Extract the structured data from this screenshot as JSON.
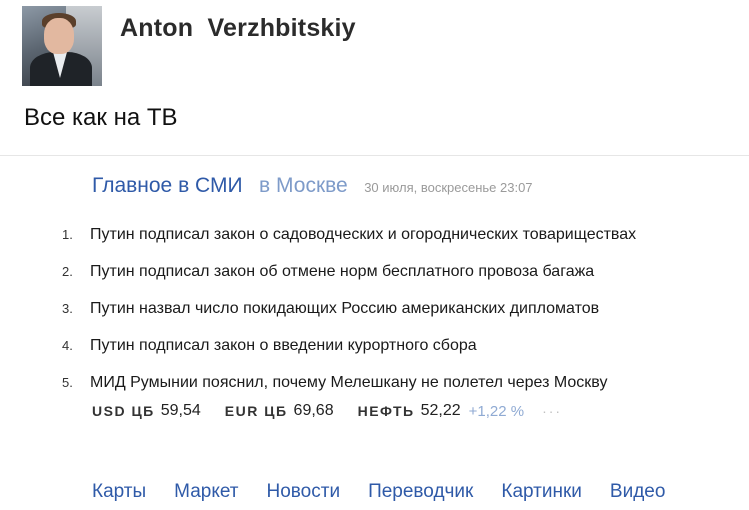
{
  "post": {
    "author": "Anton  Verzhbitskiy",
    "text": "Все как на ТВ"
  },
  "yandex_news": {
    "title": "Главное в СМИ",
    "region": "в Москве",
    "date": "30 июля, воскресенье 23:07",
    "items": [
      {
        "num": "1.",
        "text": "Путин подписал закон о садоводческих и огороднических товариществах"
      },
      {
        "num": "2.",
        "text": "Путин подписал закон об отмене норм бесплатного провоза багажа"
      },
      {
        "num": "3.",
        "text": "Путин назвал число покидающих Россию американских дипломатов"
      },
      {
        "num": "4.",
        "text": "Путин подписал закон о введении курортного сбора"
      },
      {
        "num": "5.",
        "text": "МИД Румынии пояснил, почему Мелешкану не полетел через Москву"
      }
    ]
  },
  "rates": {
    "usd_label": "USD ЦБ",
    "usd_value": "59,54",
    "eur_label": "EUR ЦБ",
    "eur_value": "69,68",
    "oil_label": "НЕФТЬ",
    "oil_value": "52,22",
    "oil_change": "+1,22 %",
    "more": "···"
  },
  "services": [
    "Карты",
    "Маркет",
    "Новости",
    "Переводчик",
    "Картинки",
    "Видео"
  ],
  "colors": {
    "link_blue": "#2f5aa8",
    "region_blue": "#7e9bc9",
    "change_blue": "#8faad3"
  }
}
